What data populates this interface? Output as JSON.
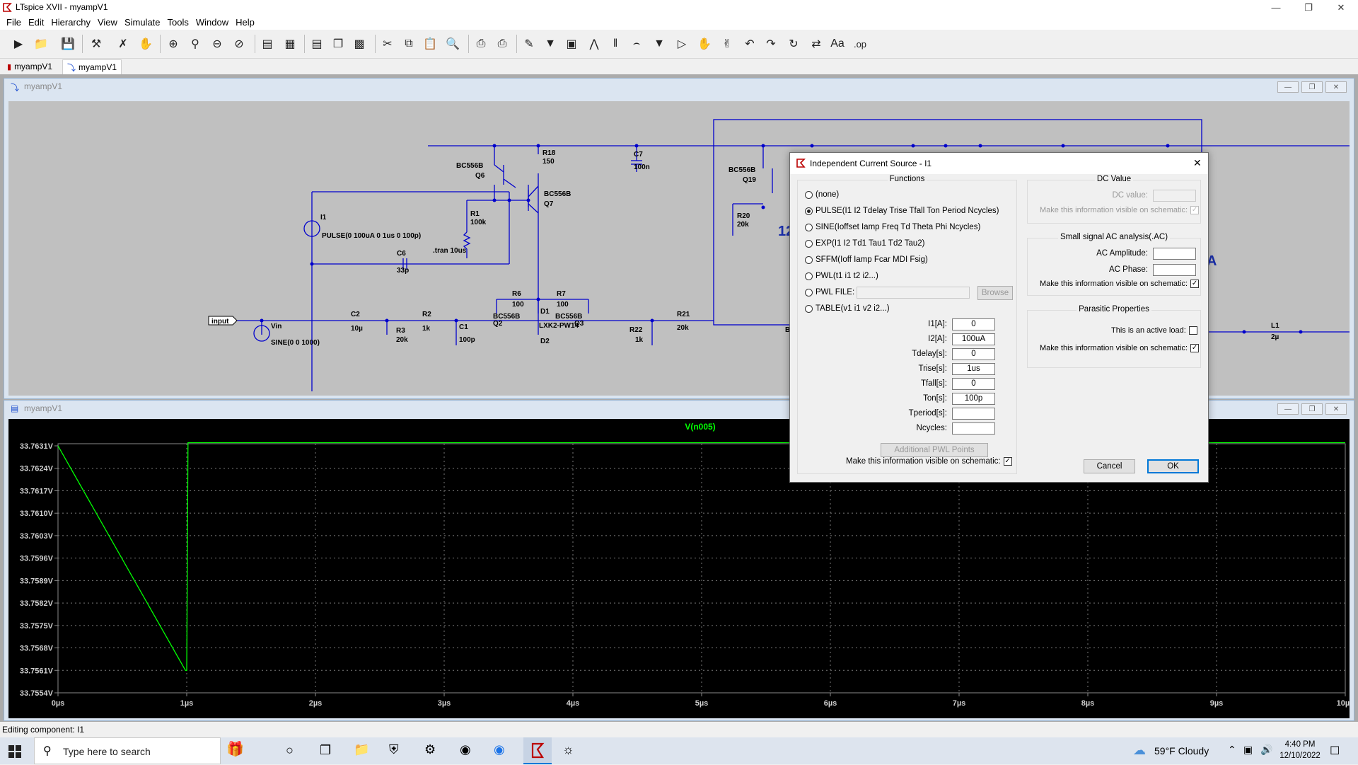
{
  "window": {
    "title": "LTspice XVII - myampV1"
  },
  "menu": [
    "File",
    "Edit",
    "Hierarchy",
    "View",
    "Simulate",
    "Tools",
    "Window",
    "Help"
  ],
  "tabs": [
    {
      "label": "myampV1"
    },
    {
      "label": "myampV1"
    }
  ],
  "schematic": {
    "title": "myampV1",
    "labels": {
      "q6": "BC556B",
      "q6n": "Q6",
      "q7": "BC556B",
      "q7n": "Q7",
      "r18": "R18",
      "r18v": "150",
      "c7": "C7",
      "c7v": "100n",
      "q19": "BC556B",
      "q19n": "Q19",
      "r20": "R20",
      "r20v": "20k",
      "r1": "R1",
      "r1v": "100k",
      "i1": "I1",
      "pulse": "PULSE(0 100uA 0 1us 0 100p)",
      "tran": ".tran 10us",
      "c6": "C6",
      "c6v": "33p",
      "r6": "R6",
      "r6v": "100",
      "r7": "R7",
      "r7v": "100",
      "d1": "D1",
      "lxk": "LXK2-PW14",
      "q2": "BC556B",
      "q2n": "Q2",
      "q3": "BC556B",
      "q3n": "Q3",
      "input": "input",
      "vin": "Vin",
      "sine": "SINE(0 0 1000)",
      "c2": "C2",
      "c2v": "10µ",
      "r3": "R3",
      "r3v": "20k",
      "r2": "R2",
      "r2v": "1k",
      "c1": "C1",
      "c1v": "100p",
      "d2": "D2",
      "r22": "R22",
      "r22v": "1k",
      "r21": "R21",
      "r21v": "20k",
      "bc": "BC",
      "twelve": "12",
      "l1": "L1",
      "l1v": "2µ",
      "a": "A"
    }
  },
  "plot": {
    "title": "myampV1",
    "trace_label": "V(n005)",
    "y_ticks": [
      "33.7631V",
      "33.7624V",
      "33.7617V",
      "33.7610V",
      "33.7603V",
      "33.7596V",
      "33.7589V",
      "33.7582V",
      "33.7575V",
      "33.7568V",
      "33.7561V",
      "33.7554V"
    ],
    "x_ticks": [
      "0µs",
      "1µs",
      "2µs",
      "3µs",
      "4µs",
      "5µs",
      "6µs",
      "7µs",
      "8µs",
      "9µs",
      "10µs"
    ]
  },
  "chart_data": {
    "type": "line",
    "title": "",
    "xlabel": "",
    "ylabel": "",
    "xlim": [
      0,
      10
    ],
    "ylim": [
      33.7554,
      33.7631
    ],
    "grid": true,
    "series": [
      {
        "name": "V(n005)",
        "color": "#00ff00",
        "x": [
          0,
          0.99,
          1.0,
          1.01,
          10
        ],
        "y": [
          33.7631,
          33.7561,
          33.7561,
          33.7632,
          33.7632
        ]
      }
    ]
  },
  "dialog": {
    "title": "Independent Current Source - I1",
    "functions_label": "Functions",
    "functions": [
      {
        "label": "(none)",
        "selected": false
      },
      {
        "label": "PULSE(I1 I2 Tdelay Trise Tfall Ton Period Ncycles)",
        "selected": true
      },
      {
        "label": "SINE(Ioffset Iamp Freq Td Theta Phi Ncycles)",
        "selected": false
      },
      {
        "label": "EXP(I1 I2 Td1 Tau1 Td2 Tau2)",
        "selected": false
      },
      {
        "label": "SFFM(Ioff Iamp Fcar MDI Fsig)",
        "selected": false
      },
      {
        "label": "PWL(t1 i1 t2 i2...)",
        "selected": false
      },
      {
        "label": "PWL FILE:",
        "selected": false
      },
      {
        "label": "TABLE(v1 i1 v2 i2...)",
        "selected": false
      }
    ],
    "browse_label": "Browse",
    "params": [
      {
        "label": "I1[A]:",
        "value": "0"
      },
      {
        "label": "I2[A]:",
        "value": "100uA"
      },
      {
        "label": "Tdelay[s]:",
        "value": "0"
      },
      {
        "label": "Trise[s]:",
        "value": "1us"
      },
      {
        "label": "Tfall[s]:",
        "value": "0"
      },
      {
        "label": "Ton[s]:",
        "value": "100p"
      },
      {
        "label": "Tperiod[s]:",
        "value": ""
      },
      {
        "label": "Ncycles:",
        "value": ""
      }
    ],
    "additional_pwl": "Additional PWL Points",
    "visible_schematic": "Make this information visible on schematic:",
    "dc_group": "DC Value",
    "dc_value_label": "DC value:",
    "dc_visible": "Make this information visible on schematic:",
    "ac_group": "Small signal AC analysis(.AC)",
    "ac_amp_label": "AC Amplitude:",
    "ac_phase_label": "AC Phase:",
    "ac_visible": "Make this information visible on schematic:",
    "parasitic_group": "Parasitic Properties",
    "active_load_label": "This is an active load:",
    "parasitic_visible": "Make this information visible on schematic:",
    "cancel_label": "Cancel",
    "ok_label": "OK"
  },
  "status": {
    "text": "Editing component: I1"
  },
  "taskbar": {
    "search_placeholder": "Type here to search",
    "weather": "59°F  Cloudy",
    "time": "4:40 PM",
    "date": "12/10/2022"
  }
}
